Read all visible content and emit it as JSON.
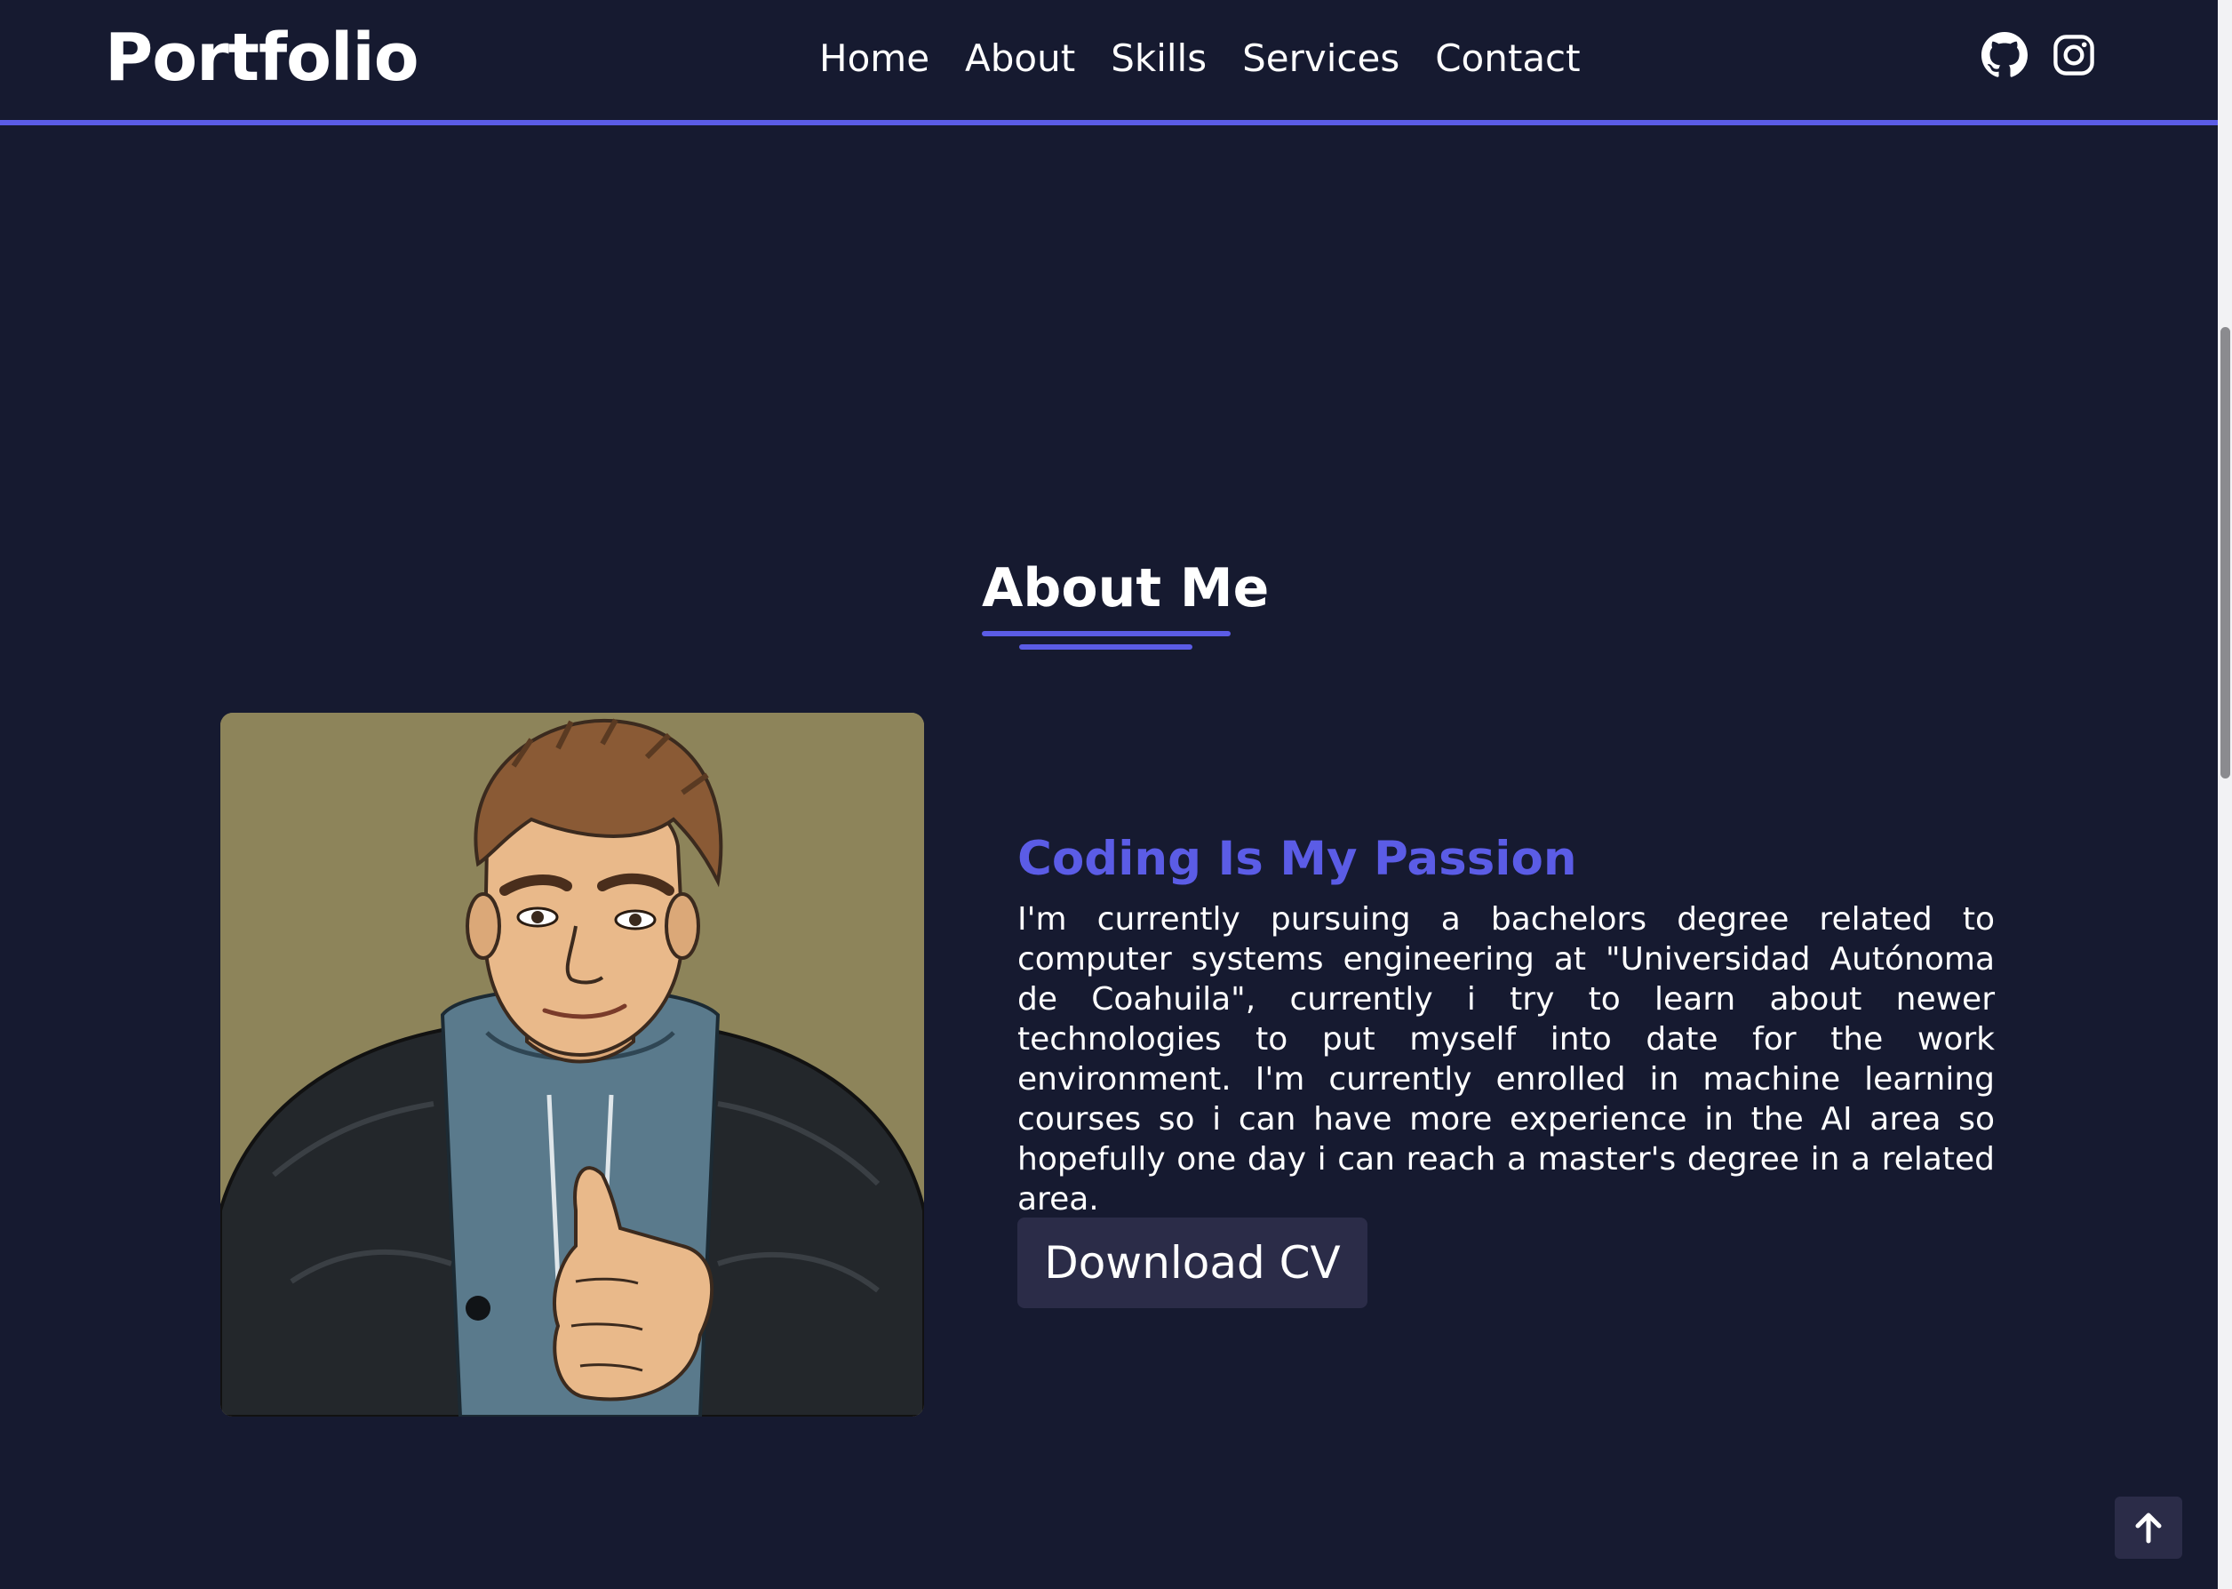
{
  "header": {
    "logo": "Portfolio",
    "nav": [
      {
        "label": "Home"
      },
      {
        "label": "About"
      },
      {
        "label": "Skills"
      },
      {
        "label": "Services"
      },
      {
        "label": "Contact"
      }
    ],
    "social_icons": [
      "github-icon",
      "instagram-icon"
    ]
  },
  "about": {
    "title": "About Me",
    "subtitle": "Coding Is My Passion",
    "bio": "I'm currently pursuing a bachelors degree related to computer systems engineering at \"Universidad Autónoma de Coahuila\", currently i try to learn about newer technologies to put myself into date for the work environment. I'm currently enrolled in machine learning courses so i can have more experience in the AI area so hopefully one day i can reach a master's degree in a related area.",
    "cv_button": "Download CV",
    "portrait_icon": "avatar-illustration"
  },
  "back_to_top_icon": "arrow-up-icon",
  "colors": {
    "background": "#161a30",
    "accent": "#5b5ce6",
    "button_bg": "#2b2c48",
    "portrait_bg": "#8d845a"
  }
}
